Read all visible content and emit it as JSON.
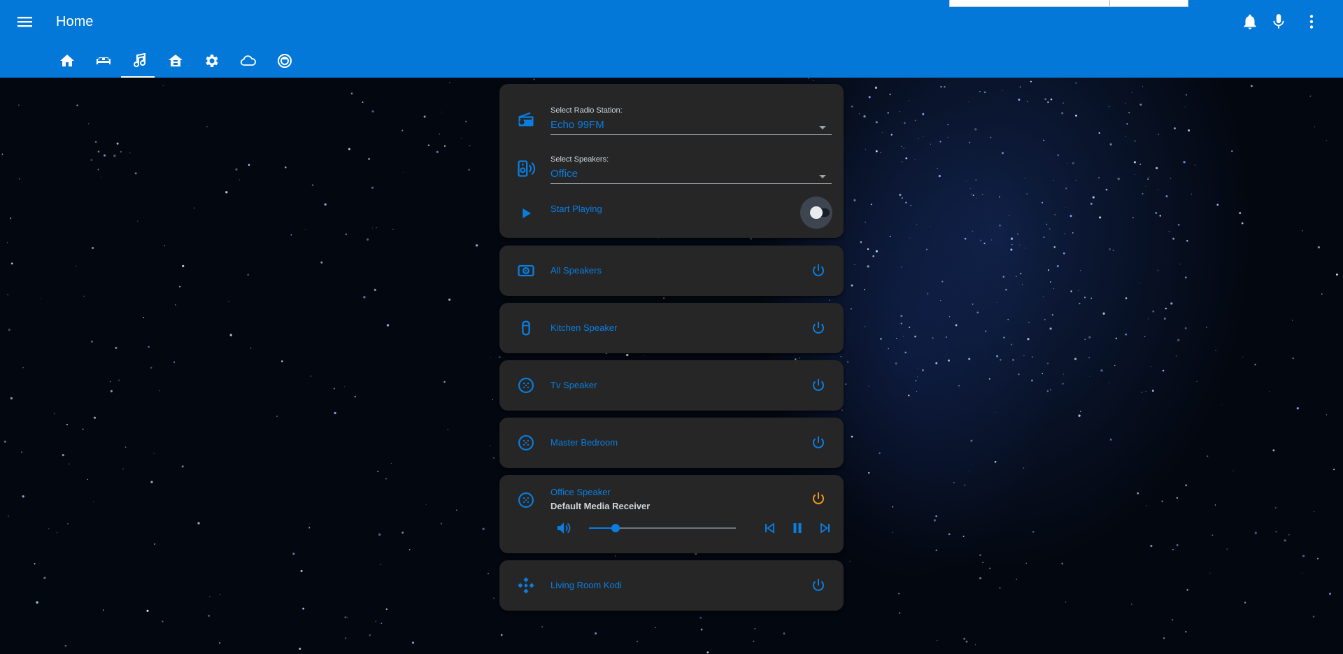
{
  "header": {
    "title": "Home",
    "tabs": [
      {
        "name": "home-icon"
      },
      {
        "name": "sofa-icon"
      },
      {
        "name": "music-icon",
        "active": true
      },
      {
        "name": "house-icon"
      },
      {
        "name": "gear-icon"
      },
      {
        "name": "cloud-icon"
      },
      {
        "name": "robot-vacuum-icon"
      }
    ],
    "actions": [
      "bell-icon",
      "microphone-icon",
      "more-vertical-icon"
    ]
  },
  "radio_card": {
    "station_label": "Select Radio Station:",
    "station_value": "Echo 99FM",
    "speakers_label": "Select Speakers:",
    "speakers_value": "Office",
    "play_label": "Start Playing",
    "play_on": false
  },
  "devices": [
    {
      "label": "All Speakers",
      "icon": "speaker-array-icon",
      "power_color": "#0a7ee0"
    },
    {
      "label": "Kitchen Speaker",
      "icon": "smart-speaker-icon",
      "power_color": "#0a7ee0"
    },
    {
      "label": "Tv Speaker",
      "icon": "cast-speaker-icon",
      "power_color": "#0a7ee0"
    },
    {
      "label": "Master Bedroom",
      "icon": "cast-speaker-icon",
      "power_color": "#0a7ee0"
    }
  ],
  "office_player": {
    "label": "Office Speaker",
    "subtitle": "Default Media Receiver",
    "icon": "cast-speaker-icon",
    "power_color": "#f29a1a",
    "volume_fraction": 0.18
  },
  "kodi": {
    "label": "Living Room Kodi",
    "icon": "kodi-icon",
    "power_color": "#0a7ee0"
  },
  "colors": {
    "header": "#0378d8",
    "accent": "#0a7ee0",
    "card": "#262626",
    "active_power": "#f29a1a"
  }
}
